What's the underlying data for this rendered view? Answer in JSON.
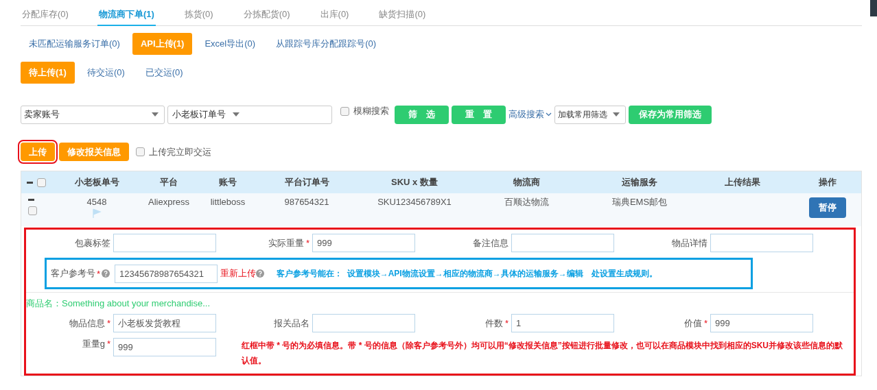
{
  "main_tabs": [
    {
      "label": "分配库存(0)",
      "selected": false
    },
    {
      "label": "物流商下单(1)",
      "selected": true
    },
    {
      "label": "拣货(0)",
      "selected": false
    },
    {
      "label": "分拣配货(0)",
      "selected": false
    },
    {
      "label": "出库(0)",
      "selected": false
    },
    {
      "label": "缺货扫描(0)",
      "selected": false
    }
  ],
  "sub_tabs": [
    {
      "label": "未匹配运输服务订单(0)",
      "selected": false
    },
    {
      "label": "API上传(1)",
      "selected": true
    },
    {
      "label": "Excel导出(0)",
      "selected": false
    },
    {
      "label": "从跟踪号库分配跟踪号(0)",
      "selected": false
    }
  ],
  "status_tabs": [
    {
      "label": "待上传(1)",
      "selected": true
    },
    {
      "label": "待交运(0)",
      "selected": false
    },
    {
      "label": "已交运(0)",
      "selected": false
    }
  ],
  "filters": {
    "account_select": "卖家账号",
    "order_field_select": "小老板订单号",
    "fuzzy_search": {
      "label": "模糊搜索",
      "checked": false
    },
    "filter_button": "筛　选",
    "reset_button": "重　置",
    "advanced_search": "高级搜索",
    "saved_filter_select": "加载常用筛选",
    "save_filter_button": "保存为常用筛选"
  },
  "actions": {
    "buttons": [
      {
        "label": "上传",
        "highlighted": true
      },
      {
        "label": "修改报关信息",
        "highlighted": false
      }
    ],
    "ship_after_upload": {
      "label": "上传完立即交运",
      "checked": false
    }
  },
  "table": {
    "select_all_checked": false,
    "columns": [
      "小老板单号",
      "平台",
      "账号",
      "平台订单号",
      "SKU x 数量",
      "物流商",
      "运输服务",
      "上传结果",
      "操作"
    ],
    "rows": [
      {
        "checked": false,
        "expanded": true,
        "cells": [
          "4548",
          "Aliexpress",
          "littleboss",
          "987654321",
          "SKU123456789X1",
          "百顺达物流",
          "瑞典EMS邮包"
        ],
        "action": "暂停",
        "detail": {
          "fields": [
            {
              "label": "包裹标签"
            },
            {
              "label": "实际重量",
              "mark": "*",
              "value": "999"
            },
            {
              "label": "备注信息"
            },
            {
              "label": "物品详情"
            }
          ],
          "reference": {
            "label": "客户参考号",
            "mark": "*",
            "value": "12345678987654321",
            "reupload": "重新上传",
            "hint": "客户参考号能在：  设置模块→API物流设置→相应的物流商→具体的运输服务→编辑　处设置生成规则。"
          },
          "product_name": "商品名：Something about your merchandise...",
          "product_fields": [
            {
              "label": "物品信息",
              "mark": "*",
              "value": "小老板发货教程"
            },
            {
              "label": "报关品名"
            },
            {
              "label": "件数",
              "mark": "*",
              "value": "1"
            },
            {
              "label": "价值",
              "mark": "*",
              "value": "999"
            }
          ],
          "weight": {
            "label": "重量g",
            "mark": "*",
            "value": "999"
          },
          "note": "红框中带 * 号的为必填信息。带 * 号的信息（除客户参考号外）均可以用“修改报关信息”按钮进行批量修改，也可以在商品模块中找到相应的SKU并修改该些信息的默认值。"
        }
      }
    ]
  }
}
